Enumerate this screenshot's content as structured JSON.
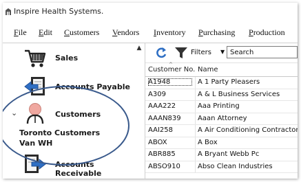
{
  "app": {
    "title": "Inspire Health Systems."
  },
  "menu": [
    {
      "label": "File",
      "accel": "F",
      "rest": "ile"
    },
    {
      "label": "Edit",
      "accel": "E",
      "rest": "dit"
    },
    {
      "label": "Customers",
      "accel": "C",
      "rest": "ustomers"
    },
    {
      "label": "Vendors",
      "accel": "V",
      "rest": "endors"
    },
    {
      "label": "Inventory",
      "accel": "I",
      "rest": "nventory"
    },
    {
      "label": "Purchasing",
      "accel": "P",
      "rest": "urchasing"
    },
    {
      "label": "Production",
      "accel": "P",
      "rest": "roduction"
    }
  ],
  "sidebar": {
    "items": [
      {
        "label": "Sales",
        "icon": "shopping-cart-icon"
      },
      {
        "label": "Accounts Payable",
        "icon": "accounts-payable-icon"
      },
      {
        "label": "Customers",
        "icon": "customer-person-icon",
        "expanded": true
      },
      {
        "label": "Accounts Receivable",
        "icon": "accounts-receivable-icon"
      }
    ],
    "customers_children": [
      "Toronto Customers",
      "Van WH"
    ]
  },
  "toolbar": {
    "filters_label": "Filters",
    "search_placeholder": "Search"
  },
  "grid": {
    "columns": [
      "Customer No.",
      "Name"
    ],
    "rows": [
      [
        "A1948",
        "A 1 Party Pleasers"
      ],
      [
        "A309",
        "A & L Business Services"
      ],
      [
        "AAA222",
        "Aaa Printing"
      ],
      [
        "AAAN839",
        "Aaan Attorney"
      ],
      [
        "AAI258",
        "A Air Conditioning Contractor"
      ],
      [
        "ABOX",
        "A Box"
      ],
      [
        "ABR885",
        "A Bryant Webb Pc"
      ],
      [
        "ABSO910",
        "Abso Clean Industries"
      ]
    ]
  },
  "colors": {
    "highlight_ring": "#3a5a8c",
    "avatar_head": "#f0a8a0",
    "refresh_blue": "#2f6fc4"
  }
}
